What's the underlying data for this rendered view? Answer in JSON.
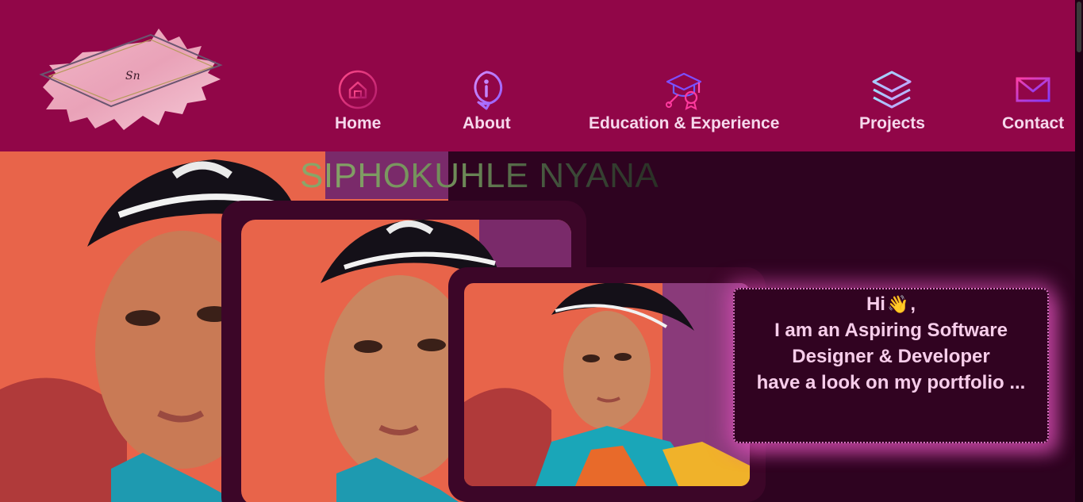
{
  "header": {
    "logo_initials": "Sn",
    "nav": [
      {
        "label": "Home",
        "icon": "home-icon"
      },
      {
        "label": "About",
        "icon": "info-icon"
      },
      {
        "label": "Education & Experience",
        "icon": "graduation-cap-icon"
      },
      {
        "label": "Projects",
        "icon": "layers-icon"
      },
      {
        "label": "Contact",
        "icon": "mail-icon"
      }
    ]
  },
  "hero": {
    "title": "SIPHOKUHLE NYANA",
    "greeting": {
      "hi": "Hi",
      "wave": "👋",
      "comma": ",",
      "line1": "I am an Aspiring Software",
      "line2": "Designer & Developer",
      "line3": "have a look on my portfolio ..."
    }
  },
  "colors": {
    "header_bg": "#910648",
    "page_bg": "#2e0320",
    "nav_text": "#f6d8ec",
    "greeting_glow": "#ec56c4"
  }
}
